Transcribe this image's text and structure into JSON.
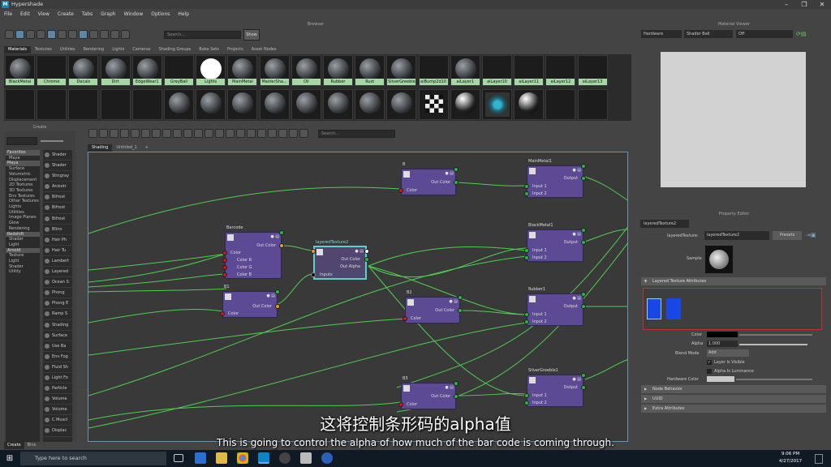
{
  "window": {
    "title": "Hypershade",
    "logo": "M"
  },
  "menu": [
    "File",
    "Edit",
    "View",
    "Create",
    "Tabs",
    "Graph",
    "Window",
    "Options",
    "Help"
  ],
  "browser": {
    "panel_title": "Browser",
    "search_placeholder": "Search...",
    "show_label": "Show",
    "tabs": [
      "Materials",
      "Textures",
      "Utilities",
      "Rendering",
      "Lights",
      "Cameras",
      "Shading Groups",
      "Bake Sets",
      "Projects",
      "Asset Nodes"
    ],
    "swatches_row1": [
      {
        "label": "BlackMetal",
        "style": "ball"
      },
      {
        "label": "Chrome",
        "style": "empty"
      },
      {
        "label": "Decals",
        "style": "ball"
      },
      {
        "label": "Dirt",
        "style": "ball"
      },
      {
        "label": "EdgeWear1",
        "style": "ball"
      },
      {
        "label": "GreyBall",
        "style": "empty"
      },
      {
        "label": "Lights",
        "style": "white"
      },
      {
        "label": "MainMetal",
        "style": "ball"
      },
      {
        "label": "MasterSha...",
        "style": "ball"
      },
      {
        "label": "Oil",
        "style": "ball"
      },
      {
        "label": "Rubber",
        "style": "ball"
      },
      {
        "label": "Rust",
        "style": "ball"
      },
      {
        "label": "SilverGreeble",
        "style": "ball"
      },
      {
        "label": "aiBump2d10",
        "style": "empty"
      },
      {
        "label": "aiLayer1",
        "style": "ball"
      },
      {
        "label": "aiLayer10",
        "style": "empty"
      },
      {
        "label": "aiLayer11",
        "style": "empty"
      },
      {
        "label": "aiLayer12",
        "style": "empty"
      },
      {
        "label": "aiLayer13",
        "style": "empty"
      }
    ],
    "swatches_row2": [
      "empty",
      "empty",
      "empty",
      "empty",
      "empty",
      "ball",
      "ball",
      "ball",
      "ball",
      "ball",
      "ball",
      "ball",
      "ball",
      "checker",
      "glossy",
      "teal",
      "glossy",
      "empty",
      "empty"
    ]
  },
  "create_panel": {
    "title": "Create",
    "categories": [
      {
        "label": "Favorites",
        "sec": true
      },
      {
        "label": "Maya",
        "sec": false
      },
      {
        "label": "Maya",
        "sec": true
      },
      {
        "label": "Surface",
        "sec": false
      },
      {
        "label": "Volumetric",
        "sec": false
      },
      {
        "label": "Displacement",
        "sec": false
      },
      {
        "label": "2D Textures",
        "sec": false
      },
      {
        "label": "3D Textures",
        "sec": false
      },
      {
        "label": "Env Textures",
        "sec": false
      },
      {
        "label": "Other Textures",
        "sec": false
      },
      {
        "label": "Lights",
        "sec": false
      },
      {
        "label": "Utilities",
        "sec": false
      },
      {
        "label": "Image Planes",
        "sec": false
      },
      {
        "label": "Glow",
        "sec": false
      },
      {
        "label": "Rendering",
        "sec": false
      },
      {
        "label": "Redshift",
        "sec": true
      },
      {
        "label": "Shader",
        "sec": false
      },
      {
        "label": "Light",
        "sec": false
      },
      {
        "label": "Arnold",
        "sec": true
      },
      {
        "label": "Texture",
        "sec": false
      },
      {
        "label": "Light",
        "sec": false
      },
      {
        "label": "Shader",
        "sec": false
      },
      {
        "label": "Utility",
        "sec": false
      }
    ],
    "items": [
      "Shader",
      "Shader",
      "Stingray",
      "Anisotr",
      "Bifrost",
      "Bifrost",
      "Bifrost",
      "Blinn",
      "Hair Ph",
      "Hair Tu",
      "Lambert",
      "Layered",
      "Ocean S",
      "Phong",
      "Phong E",
      "Ramp S",
      "Shading",
      "Surface",
      "Use Ba",
      "Env Fog",
      "Fluid Sh",
      "Light Fo",
      "Particle",
      "Volume",
      "Volume",
      "C Muscl",
      "Displac"
    ],
    "bottom_tabs": [
      "Create",
      "Bins"
    ]
  },
  "graph": {
    "search_placeholder": "Search...",
    "tabs": [
      "Shading",
      "Untitled_1",
      "+"
    ],
    "nodes": {
      "barcode": {
        "title": "Barcode",
        "out": "Out Color",
        "inputs": [
          "Color",
          "Color R",
          "Color G",
          "Color B"
        ]
      },
      "layered": {
        "title": "layeredTexture2",
        "outs": [
          "Out Color",
          "Out Alpha"
        ],
        "input": "Inputs"
      },
      "b": {
        "title": "B",
        "out": "Out Color",
        "input": "Color"
      },
      "b1": {
        "title": "B1",
        "out": "Out Color",
        "input": "Color"
      },
      "b2": {
        "title": "B2",
        "out": "Out Color",
        "input": "Color"
      },
      "b3": {
        "title": "B3",
        "out": "Out Color",
        "input": "Color"
      },
      "mainmetal": {
        "title": "MainMetal1",
        "out": "Output",
        "inputs": [
          "Input 1",
          "Input 2"
        ]
      },
      "blackmetal": {
        "title": "BlackMetal1",
        "out": "Output",
        "inputs": [
          "Input 1",
          "Input 2"
        ]
      },
      "rubber": {
        "title": "Rubber1",
        "out": "Output",
        "inputs": [
          "Input 1",
          "Input 2"
        ]
      },
      "silver": {
        "title": "SilverGreeble1",
        "out": "Output",
        "inputs": [
          "Input 1",
          "Input 2"
        ]
      }
    }
  },
  "material_viewer": {
    "title": "Material Viewer",
    "renderer": "Hardware",
    "shape": "Shader Ball",
    "mode": "Off"
  },
  "property_editor": {
    "title": "Property Editor",
    "tab": "layeredTexture2",
    "node_label": "layeredTexture:",
    "node_value": "layeredTexture2",
    "presets": "Presets",
    "sample_label": "Sample",
    "sections": {
      "layered": "Layered Texture Attributes",
      "node_behavior": "Node Behavior",
      "uuid": "UUID",
      "extra": "Extra Attributes"
    },
    "color_label": "Color",
    "alpha_label": "Alpha",
    "alpha_value": "1.000",
    "blend_label": "Blend Mode",
    "blend_value": "Add",
    "layer_visible": "Layer Is Visible",
    "alpha_lum": "Alpha Is Luminance",
    "hw_color": "Hardware Color"
  },
  "subtitles": {
    "cn": "这将控制条形码的alpha值",
    "en": "This is going to control the alpha of how much of the bar code is coming through."
  },
  "taskbar": {
    "search": "Type here to search",
    "time": "9:06 PM",
    "date": "4/27/2017"
  }
}
